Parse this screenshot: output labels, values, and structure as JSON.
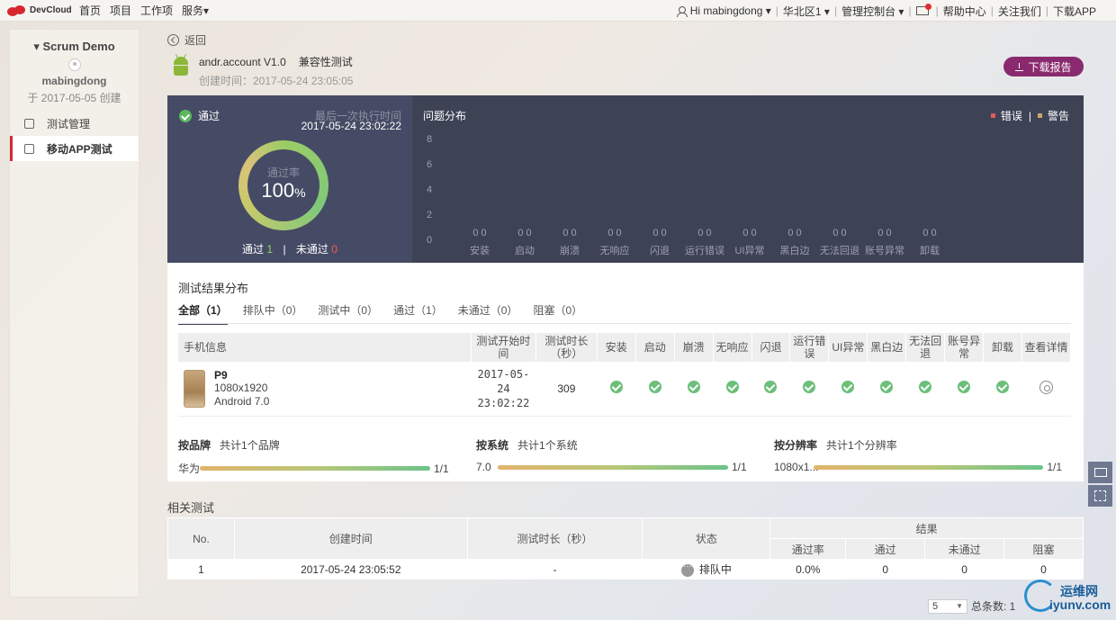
{
  "topbar": {
    "brand": "DevCloud",
    "nav": [
      "首页",
      "项目",
      "工作项",
      "服务▾"
    ],
    "user": "Hi mabingdong ▾",
    "region": "华北区1 ▾",
    "console": "管理控制台 ▾",
    "help": "帮助中心",
    "follow": "关注我们",
    "download_app": "下载APP"
  },
  "sidebar": {
    "project": "▾ Scrum Demo",
    "user": "mabingdong",
    "created": "于 2017-05-05 创建",
    "items": [
      {
        "label": "测试管理",
        "active": false
      },
      {
        "label": "移动APP测试",
        "active": true
      }
    ]
  },
  "header": {
    "back": "返回",
    "app_name": "andr.account V1.0",
    "test_type": "兼容性测试",
    "created": "创建时间：2017-05-24 23:05:05",
    "download_report": "下载报告"
  },
  "summary_panel": {
    "status": "通过",
    "last_exec_label": "最后一次执行时间",
    "last_exec_time": "2017-05-24 23:02:22",
    "rate_label": "通过率",
    "rate_value": "100",
    "rate_unit": "%",
    "pass_rate_fraction": 1.0,
    "passed_label": "通过",
    "passed_count": "1",
    "failed_label": "未通过",
    "failed_count": "0"
  },
  "chart_data": {
    "type": "bar",
    "title": "问题分布",
    "legend": [
      "错误",
      "警告"
    ],
    "legend_colors": [
      "#e05a5a",
      "#c9a66b"
    ],
    "categories": [
      "安装",
      "启动",
      "崩溃",
      "无响应",
      "闪退",
      "运行错误",
      "UI异常",
      "黑白边",
      "无法回退",
      "账号异常",
      "卸载"
    ],
    "series": [
      {
        "name": "错误",
        "values": [
          0,
          0,
          0,
          0,
          0,
          0,
          0,
          0,
          0,
          0,
          0
        ]
      },
      {
        "name": "警告",
        "values": [
          0,
          0,
          0,
          0,
          0,
          0,
          0,
          0,
          0,
          0,
          0
        ]
      }
    ],
    "y_ticks": [
      "8",
      "6",
      "4",
      "2",
      "0"
    ],
    "ylim": [
      0,
      8
    ]
  },
  "results": {
    "title": "测试结果分布",
    "tabs": [
      "全部（1）",
      "排队中（0）",
      "测试中（0）",
      "通过（1）",
      "未通过（0）",
      "阻塞（0）"
    ],
    "columns": [
      "手机信息",
      "测试开始时间",
      "测试时长（秒）",
      "安装",
      "启动",
      "崩溃",
      "无响应",
      "闪退",
      "运行错误",
      "UI异常",
      "黑白边",
      "无法回退",
      "账号异常",
      "卸载",
      "查看详情"
    ],
    "rows": [
      {
        "device": "P9",
        "resolution": "1080x1920",
        "os": "Android 7.0",
        "start_date": "2017-05-24",
        "start_time": "23:02:22",
        "duration": "309"
      }
    ],
    "brand_summary": {
      "label": "按品牌",
      "total": "共计1个品牌",
      "key": "华为",
      "value": "1/1"
    },
    "system_summary": {
      "label": "按系统",
      "total": "共计1个系统",
      "key": "7.0",
      "value": "1/1"
    },
    "resolution_summary": {
      "label": "按分辨率",
      "total": "共计1个分辨率",
      "key": "1080x1...",
      "value": "1/1"
    }
  },
  "related": {
    "title": "相关测试",
    "columns": {
      "no": "No.",
      "created": "创建时间",
      "duration": "测试时长（秒）",
      "status": "状态",
      "result": "结果",
      "pass_rate": "通过率",
      "passed": "通过",
      "failed": "未通过",
      "blocked": "阻塞"
    },
    "rows": [
      {
        "no": "1",
        "created": "2017-05-24 23:05:52",
        "duration": "-",
        "status": "排队中",
        "pass_rate": "0.0%",
        "passed": "0",
        "failed": "0",
        "blocked": "0"
      }
    ]
  },
  "pager": {
    "page_size": "5",
    "total": "总条数: 1"
  },
  "watermark": {
    "line1": "运维网",
    "line2": "iyunv.com"
  }
}
